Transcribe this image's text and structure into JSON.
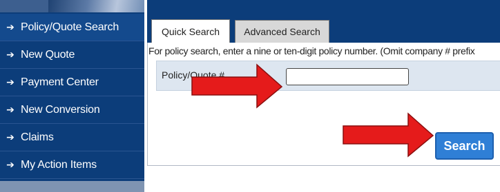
{
  "sidebar": {
    "items": [
      {
        "label": "Policy/Quote Search",
        "active": true
      },
      {
        "label": "New Quote",
        "active": false
      },
      {
        "label": "Payment Center",
        "active": false
      },
      {
        "label": "New Conversion",
        "active": false
      },
      {
        "label": "Claims",
        "active": false
      },
      {
        "label": "My Action Items",
        "active": false
      }
    ],
    "arrow_glyph": "➔"
  },
  "tabs": {
    "quick": "Quick Search",
    "advanced": "Advanced Search",
    "active": "Quick Search"
  },
  "main": {
    "instructions": "For policy search, enter a nine or ten-digit policy number. (Omit company # prefix",
    "field_label": "Policy/Quote #",
    "field_value": "",
    "search_label": "Search"
  },
  "colors": {
    "sidebar_bg": "#0c3d7a",
    "button_bg": "#2f7fd6",
    "annotation_red": "#e51b1b"
  },
  "annotations": [
    "red-arrow-pointing-to-policy-input",
    "red-arrow-pointing-to-search-button"
  ]
}
